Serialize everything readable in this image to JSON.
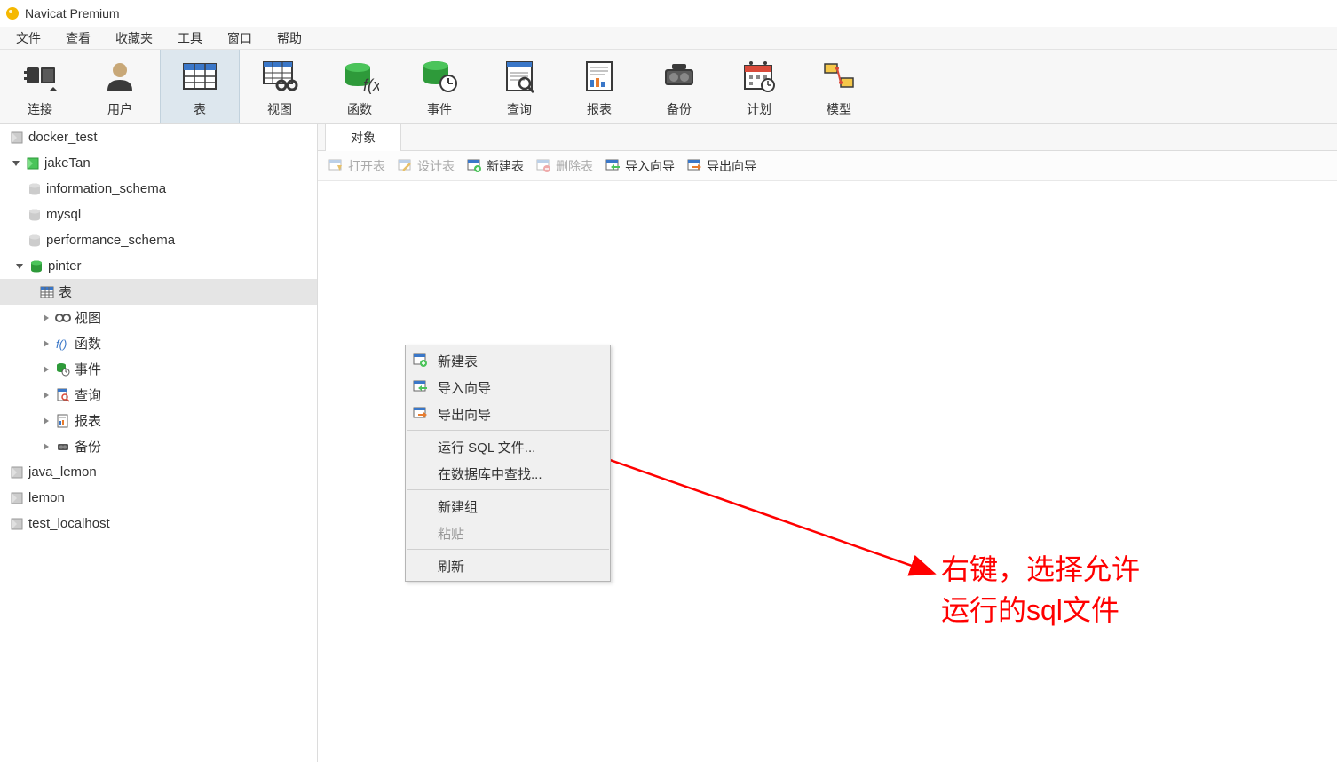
{
  "title": "Navicat Premium",
  "menubar": [
    "文件",
    "查看",
    "收藏夹",
    "工具",
    "窗口",
    "帮助"
  ],
  "toolbar": [
    {
      "label": "连接"
    },
    {
      "label": "用户"
    },
    {
      "label": "表",
      "active": true
    },
    {
      "label": "视图"
    },
    {
      "label": "函数"
    },
    {
      "label": "事件"
    },
    {
      "label": "查询"
    },
    {
      "label": "报表"
    },
    {
      "label": "备份"
    },
    {
      "label": "计划"
    },
    {
      "label": "模型"
    }
  ],
  "tree": {
    "conn_docker": "docker_test",
    "conn_jaketan": "jakeTan",
    "db_info_schema": "information_schema",
    "db_mysql": "mysql",
    "db_perf_schema": "performance_schema",
    "db_pinter": "pinter",
    "node_tables": "表",
    "node_views": "视图",
    "node_functions": "函数",
    "node_events": "事件",
    "node_queries": "查询",
    "node_reports": "报表",
    "node_backups": "备份",
    "conn_java_lemon": "java_lemon",
    "conn_lemon": "lemon",
    "conn_test_localhost": "test_localhost"
  },
  "tab": {
    "objects": "对象"
  },
  "objectToolbar": {
    "open_table": "打开表",
    "design_table": "设计表",
    "new_table": "新建表",
    "delete_table": "删除表",
    "import_wizard": "导入向导",
    "export_wizard": "导出向导"
  },
  "contextMenu": {
    "new_table": "新建表",
    "import_wizard": "导入向导",
    "export_wizard": "导出向导",
    "run_sql": "运行 SQL 文件...",
    "find_in_db": "在数据库中查找...",
    "new_group": "新建组",
    "paste": "粘贴",
    "refresh": "刷新"
  },
  "annotation": {
    "line1": "右键，选择允许",
    "line2": "运行的sql文件"
  }
}
